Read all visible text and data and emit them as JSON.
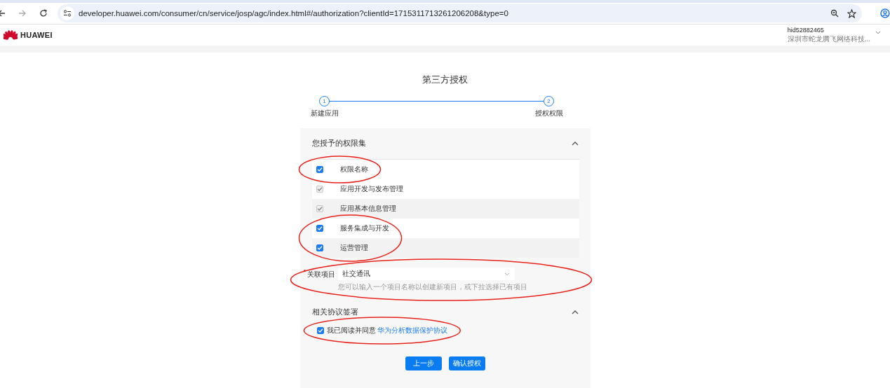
{
  "browser": {
    "url": "developer.huawei.com/consumer/cn/service/josp/agc/index.html#/authorization?clientId=1715311713261206208&type=0"
  },
  "header": {
    "brand": "HUAWEI",
    "account": {
      "id": "hid52882465",
      "company": "深圳市蛇龙腾飞网络科技..."
    }
  },
  "title": "第三方授权",
  "steps": [
    {
      "number": "1",
      "label": "新建应用"
    },
    {
      "number": "2",
      "label": "授权权限"
    }
  ],
  "permissions": {
    "heading": "您授予的权限集",
    "expanded": true,
    "rows": [
      {
        "label": "权限名称",
        "checked": true,
        "disabled": false,
        "circled": true,
        "kind": "header"
      },
      {
        "label": "应用开发与发布管理",
        "checked": true,
        "disabled": true,
        "circled": false,
        "kind": "row"
      },
      {
        "label": "应用基本信息管理",
        "checked": true,
        "disabled": true,
        "circled": false,
        "kind": "row"
      },
      {
        "label": "服务集成与开发",
        "checked": true,
        "disabled": false,
        "circled": true,
        "kind": "row"
      },
      {
        "label": "运营管理",
        "checked": true,
        "disabled": false,
        "circled": true,
        "kind": "row"
      }
    ],
    "project": {
      "label": "关联项目",
      "required": true,
      "value": "社交通讯",
      "hint": "您可以输入一个项目名称以创建新项目，或下拉选择已有项目",
      "circled": true
    }
  },
  "agreement": {
    "heading": "相关协议签署",
    "expanded": true,
    "checked": true,
    "text": "我已阅读并同意",
    "link": "华为分析数据保护协议",
    "circled": true
  },
  "buttons": [
    "上一步",
    "确认授权"
  ]
}
